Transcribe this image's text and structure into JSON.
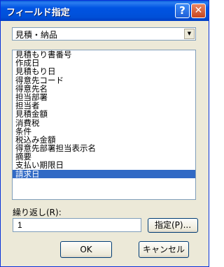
{
  "window": {
    "title": "フィールド指定",
    "help_label": "?",
    "close_label": "✕"
  },
  "combo": {
    "value": "見積・納品",
    "arrow": "▼"
  },
  "field_list": {
    "items": [
      "見積もり書番号",
      "作成日",
      "見積もり日",
      "得意先コード",
      "得意先名",
      "担当部署",
      "担当者",
      "見積金額",
      "消費税",
      "条件",
      "税込み金額",
      "得意先部署担当表示名",
      "摘要",
      "支払い期限日",
      "請求日"
    ],
    "selected": "請求日"
  },
  "repeat": {
    "label": "繰り返し(R):",
    "value": "1"
  },
  "buttons": {
    "specify": "指定(P)...",
    "ok": "OK",
    "cancel": "キャンセル"
  },
  "colors": {
    "titlebar": "#0054e3",
    "selection": "#316ac5",
    "dialog_bg": "#ece9d8"
  }
}
